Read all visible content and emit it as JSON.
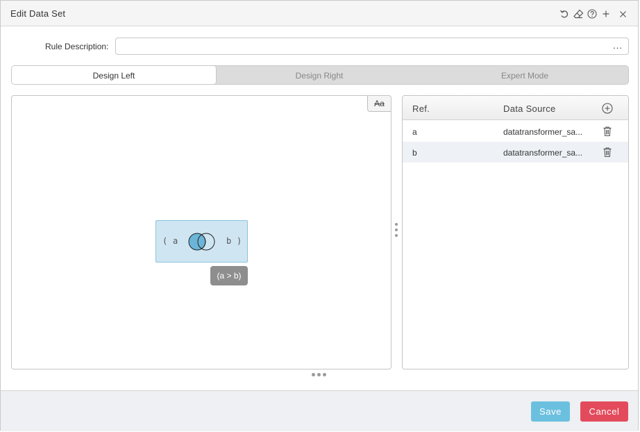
{
  "dialog": {
    "title": "Edit Data Set",
    "icons": [
      "undo-icon",
      "eraser-icon",
      "help-icon",
      "plus-icon",
      "close-icon"
    ]
  },
  "rule": {
    "label": "Rule Description:",
    "value": "",
    "ellipsis": "..."
  },
  "tabs": [
    {
      "label": "Design Left",
      "active": true
    },
    {
      "label": "Design Right",
      "active": false
    },
    {
      "label": "Expert Mode",
      "active": false
    }
  ],
  "canvas": {
    "font_toggle_label": "Aa",
    "join": {
      "open_paren": "(",
      "left_ref": "a",
      "right_ref": "b",
      "close_paren": ")",
      "icon": "venn-left-join-icon"
    },
    "expression": "(a > b)"
  },
  "refs_table": {
    "headers": {
      "ref": "Ref.",
      "source": "Data Source"
    },
    "rows": [
      {
        "ref": "a",
        "source": "datatransformer_sa..."
      },
      {
        "ref": "b",
        "source": "datatransformer_sa..."
      }
    ]
  },
  "footer": {
    "save_label": "Save",
    "cancel_label": "Cancel"
  },
  "colors": {
    "accent_save": "#6cc0df",
    "accent_cancel": "#e34b5c",
    "join_fill": "#cfe6f2",
    "venn_fill": "#6bb5d8"
  }
}
